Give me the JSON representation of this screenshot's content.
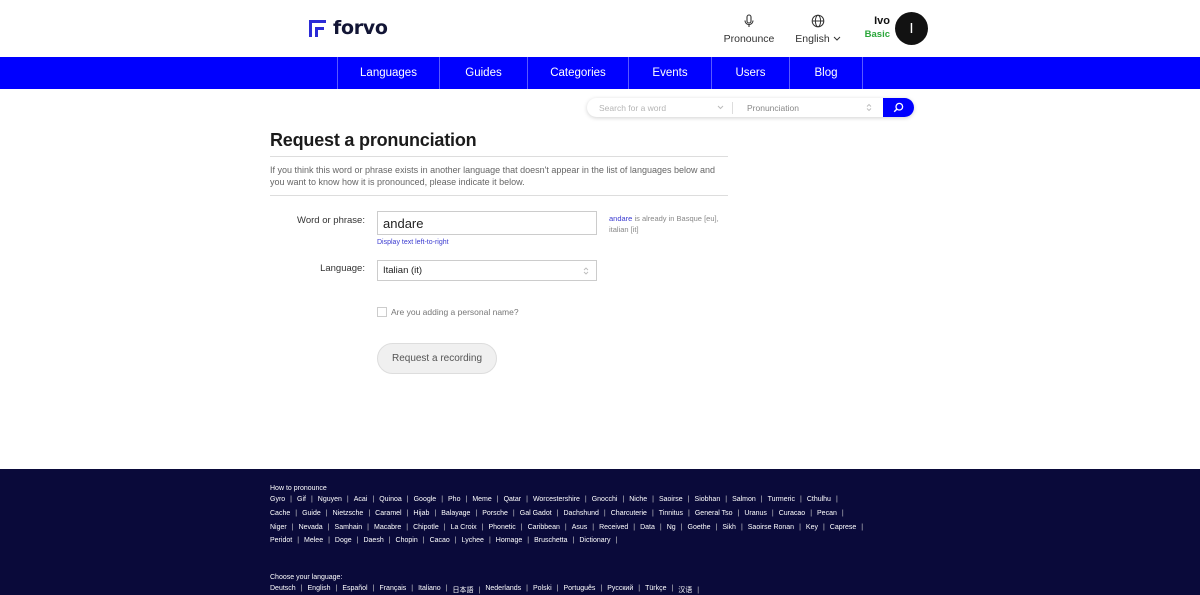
{
  "header": {
    "logo_text": "forvo",
    "pronounce_label": "Pronounce",
    "language_label": "English",
    "user_name": "Ivo",
    "user_plan": "Basic",
    "avatar_letter": "I"
  },
  "nav": {
    "items": [
      "Languages",
      "Guides",
      "Categories",
      "Events",
      "Users",
      "Blog"
    ]
  },
  "search": {
    "placeholder": "Search for a word",
    "type": "Pronunciation"
  },
  "main": {
    "title": "Request a pronunciation",
    "intro": "If you think this word or phrase exists in another language that doesn't appear in the list of languages below and you want to know how it is pronounced, please indicate it below.",
    "word_label": "Word or phrase:",
    "word_value": "andare",
    "rtl_link": "Display text left-to-right",
    "exists_word": "andare",
    "exists_text": " is already in Basque [eu], italian [it]",
    "language_label": "Language:",
    "language_value": "Italian (it)",
    "personal_name_label": "Are you adding a personal name?",
    "request_button": "Request a recording"
  },
  "footer": {
    "how_to_label": "How to pronounce",
    "rows": [
      [
        "Gyro",
        "Gif",
        "Nguyen",
        "Acai",
        "Quinoa",
        "Google",
        "Pho",
        "Meme",
        "Qatar",
        "Worcestershire",
        "Gnocchi",
        "Niche",
        "Saoirse",
        "Siobhan",
        "Salmon",
        "Turmeric",
        "Cthulhu"
      ],
      [
        "Cache",
        "Guide",
        "Nietzsche",
        "Caramel",
        "Hijab",
        "Balayage",
        "Porsche",
        "Gal Gadot",
        "Dachshund",
        "Charcuterie",
        "Tinnitus",
        "General Tso",
        "Uranus",
        "Curacao",
        "Pecan"
      ],
      [
        "Niger",
        "Nevada",
        "Samhain",
        "Macabre",
        "Chipotle",
        "La Croix",
        "Phonetic",
        "Caribbean",
        "Asus",
        "Received",
        "Data",
        "Ng",
        "Goethe",
        "Sikh",
        "Saoirse Ronan",
        "Key",
        "Caprese"
      ],
      [
        "Peridot",
        "Melee",
        "Doge",
        "Daesh",
        "Chopin",
        "Cacao",
        "Lychee",
        "Homage",
        "Bruschetta",
        "Dictionary"
      ]
    ],
    "choose_language_label": "Choose your language:",
    "languages": [
      "Deutsch",
      "English",
      "Español",
      "Français",
      "Italiano",
      "日本語",
      "Nederlands",
      "Polski",
      "Português",
      "Русский",
      "Türkçe",
      "汉语"
    ]
  }
}
